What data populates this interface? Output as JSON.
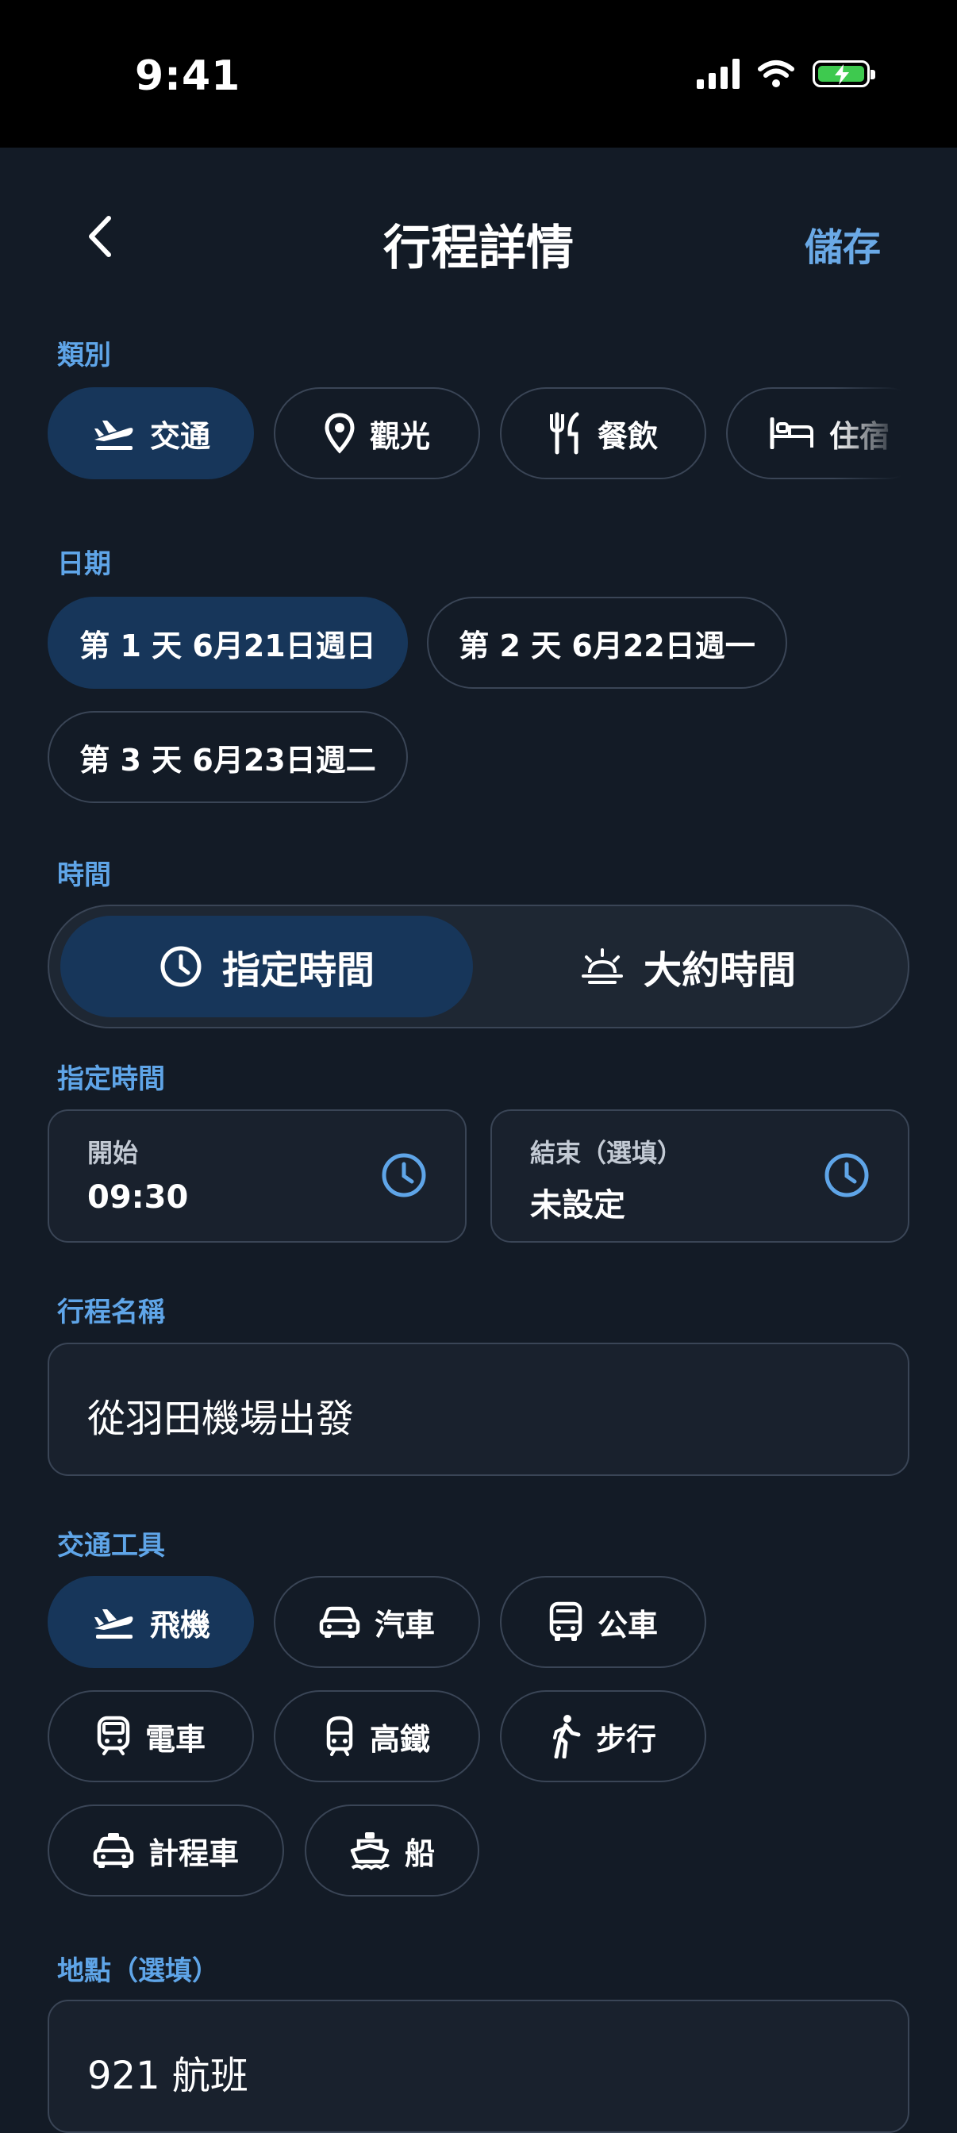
{
  "status_bar": {
    "time": "9:41"
  },
  "header": {
    "title": "行程詳情",
    "save_label": "儲存"
  },
  "category": {
    "label": "類別",
    "chips": [
      {
        "label": "交通",
        "icon": "airplane-icon",
        "selected": true
      },
      {
        "label": "觀光",
        "icon": "map-pin-icon",
        "selected": false
      },
      {
        "label": "餐飲",
        "icon": "fork-knife-icon",
        "selected": false
      },
      {
        "label": "住宿",
        "icon": "bed-icon",
        "selected": false
      }
    ]
  },
  "date": {
    "label": "日期",
    "chips": [
      {
        "label": "第 1 天 6月21日週日",
        "selected": true
      },
      {
        "label": "第 2 天 6月22日週一",
        "selected": false
      },
      {
        "label": "第 3 天 6月23日週二",
        "selected": false
      }
    ]
  },
  "time_mode": {
    "label": "時間",
    "options": [
      {
        "label": "指定時間",
        "icon": "clock-icon",
        "selected": true
      },
      {
        "label": "大約時間",
        "icon": "sunrise-icon",
        "selected": false
      }
    ]
  },
  "specific_time": {
    "label": "指定時間",
    "start": {
      "label": "開始",
      "value": "09:30"
    },
    "end": {
      "label": "結束（選填）",
      "value": "未設定"
    }
  },
  "item_name": {
    "label": "行程名稱",
    "value": "從羽田機場出發"
  },
  "transport": {
    "label": "交通工具",
    "chips": [
      {
        "label": "飛機",
        "icon": "airplane-icon",
        "selected": true
      },
      {
        "label": "汽車",
        "icon": "car-icon",
        "selected": false
      },
      {
        "label": "公車",
        "icon": "bus-icon",
        "selected": false
      },
      {
        "label": "電車",
        "icon": "train-icon",
        "selected": false
      },
      {
        "label": "高鐵",
        "icon": "high-speed-rail-icon",
        "selected": false
      },
      {
        "label": "步行",
        "icon": "walking-icon",
        "selected": false
      },
      {
        "label": "計程車",
        "icon": "taxi-icon",
        "selected": false
      },
      {
        "label": "船",
        "icon": "boat-icon",
        "selected": false
      }
    ]
  },
  "location": {
    "label": "地點（選填）",
    "value": "921 航班"
  },
  "colors": {
    "accent": "#5fa5e8",
    "selected_bg": "#17365a",
    "background": "#131b26",
    "border": "#3a4556"
  }
}
